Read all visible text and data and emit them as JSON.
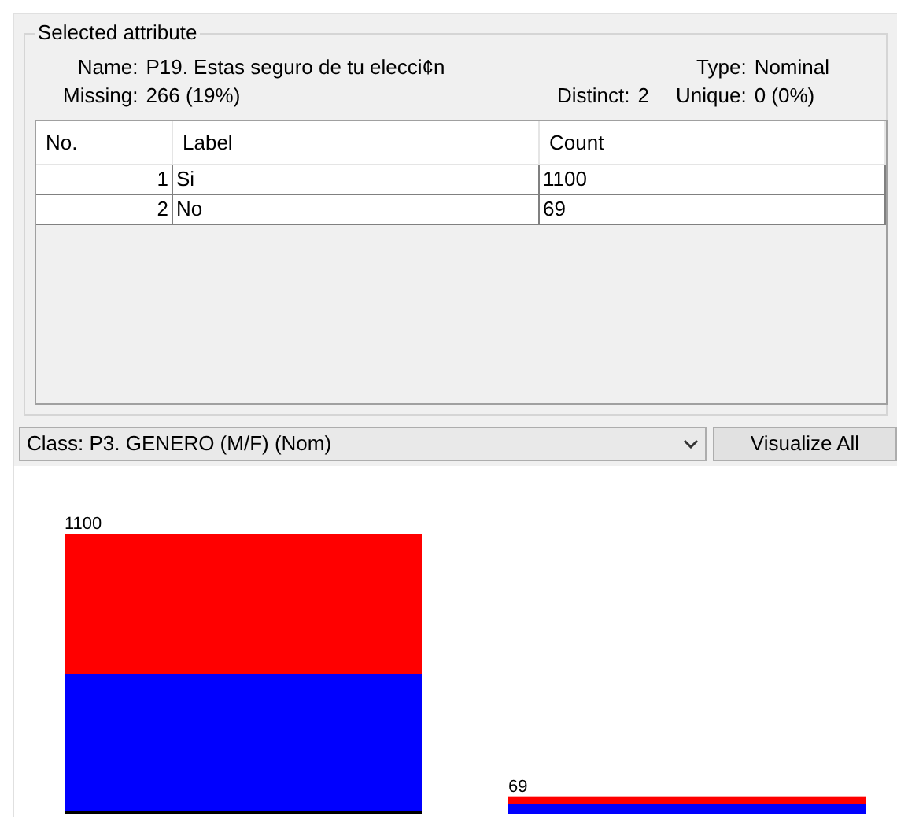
{
  "group_title": "Selected attribute",
  "info": {
    "name_label": "Name:",
    "name": "P19. Estas seguro de tu elecci¢n",
    "type_label": "Type:",
    "type": "Nominal",
    "missing_label": "Missing:",
    "missing": "266 (19%)",
    "distinct_label": "Distinct:",
    "distinct": "2",
    "unique_label": "Unique:",
    "unique": "0 (0%)"
  },
  "table": {
    "columns": [
      "No.",
      "Label",
      "Count"
    ],
    "rows": [
      [
        "1",
        "Si",
        "1100"
      ],
      [
        "2",
        "No",
        "69"
      ]
    ]
  },
  "class_select": {
    "value": "Class: P3. GENERO (M/F) (Nom)"
  },
  "visualize_button": "Visualize All",
  "histogram": {
    "bars": [
      {
        "count": "1100"
      },
      {
        "count": "69"
      }
    ]
  }
}
